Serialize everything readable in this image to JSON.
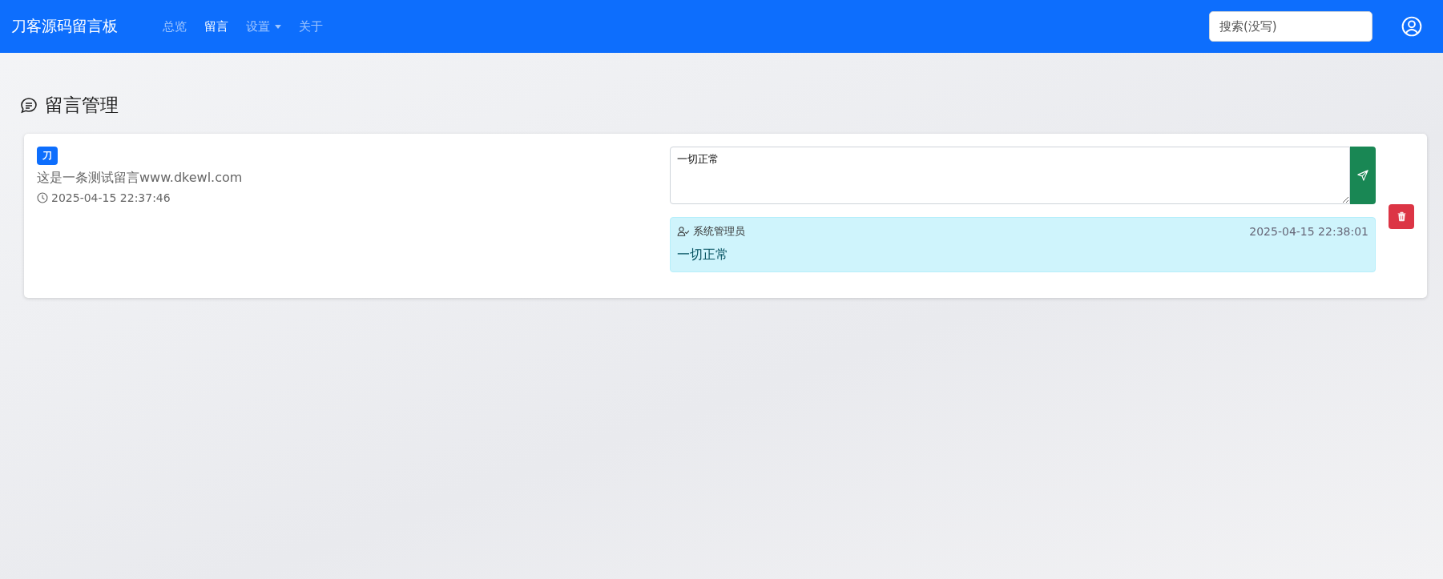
{
  "navbar": {
    "brand": "刀客源码留言板",
    "items": [
      {
        "label": "总览",
        "selected": false,
        "kind": "link"
      },
      {
        "label": "留言",
        "selected": true,
        "kind": "link"
      },
      {
        "label": "设置",
        "selected": false,
        "kind": "dropdown"
      },
      {
        "label": "关于",
        "selected": false,
        "kind": "link"
      }
    ],
    "search": {
      "placeholder": "搜索(没写)"
    }
  },
  "page_title": "留言管理",
  "messages": [
    {
      "badge": "刀",
      "text": "这是一条测试留言www.dkewl.com",
      "time": "2025-04-15 22:37:46",
      "reply_input": {
        "value": "一切正常"
      },
      "replies": [
        {
          "author": "系统管理员",
          "time": "2025-04-15 22:38:01",
          "text": "一切正常"
        }
      ]
    }
  ]
}
